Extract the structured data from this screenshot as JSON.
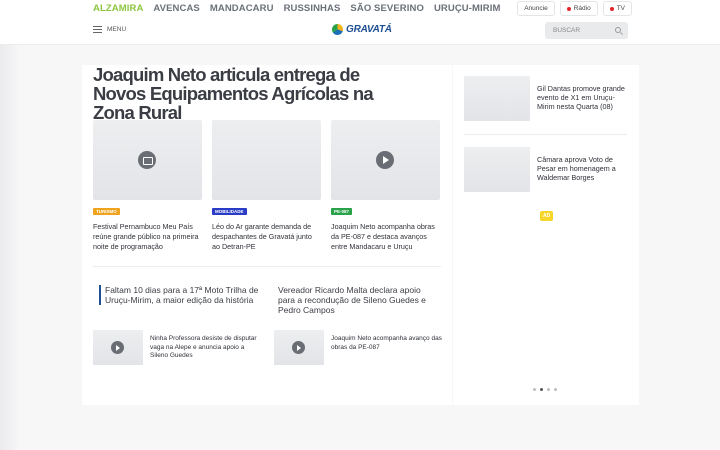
{
  "top_nav": {
    "cities": [
      {
        "label": "ALZAMIRA",
        "active": true
      },
      {
        "label": "AVENCAS",
        "active": false
      },
      {
        "label": "MANDACARU",
        "active": false
      },
      {
        "label": "RUSSINHAS",
        "active": false
      },
      {
        "label": "SÃO SEVERINO",
        "active": false
      },
      {
        "label": "URUÇU-MIRIM",
        "active": false
      }
    ],
    "anuncie": "Anuncie",
    "radio": "Rádio",
    "tv": "TV"
  },
  "header": {
    "menu_label": "MENU",
    "logo_text": "GRAVATÁ",
    "search_placeholder": "BUSCAR"
  },
  "main": {
    "headline": "Joaquim Neto articula entrega de Novos Equipamentos Agrícolas na Zona Rural",
    "cards": [
      {
        "tag": "TURISMO",
        "tag_color": "#f0a31c",
        "title": "Festival Pernambuco Meu País reúne grande público na primeira noite de programação",
        "media": "gallery-icon"
      },
      {
        "tag": "MOBILIDADE",
        "tag_color": "#2a3cc6",
        "title": "Léo do Ar garante demanda de despachantes de Gravatá junto ao Detran-PE",
        "media": "none"
      },
      {
        "tag": "PE-087",
        "tag_color": "#2aa24a",
        "title": "Joaquim Neto acompanha obras da PE-087 e destaca avanços entre Mandacaru e Uruçu",
        "media": "play-icon"
      }
    ],
    "sub_headlines": [
      "Faltam 10 dias para a 17ª Moto Trilha de Uruçu-Mirim, a maior edição da história",
      "Vereador Ricardo Malta declara apoio para a recondução de Sileno Guedes e Pedro Campos"
    ],
    "mini_items": [
      "Ninha Professora desiste de disputar vaga na Alepe e anuncia apoio a Sileno Guedes",
      "Joaquim Neto acompanha avanço das obras da PE-087"
    ]
  },
  "sidebar": {
    "items": [
      "Gil Dantas promove grande evento de X1 em Uruçu-Mirim nesta Quarta (08)",
      "Câmara aprova Voto de Pesar em homenagem a Waldemar Borges"
    ],
    "ad_label": "AD",
    "carousel_active_index": 1
  }
}
